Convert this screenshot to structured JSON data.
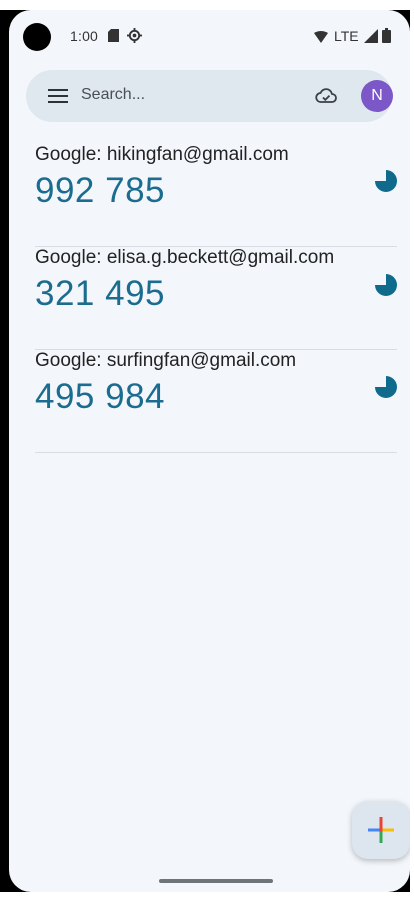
{
  "status_bar": {
    "time": "1:00",
    "network": "LTE",
    "icons": [
      "camera-cutout",
      "sd-card-icon",
      "gear-icon",
      "wifi-icon",
      "signal-icon",
      "battery-icon"
    ]
  },
  "search": {
    "placeholder": "Search...",
    "left_icon": "menu-icon",
    "right_icon": "cloud-sync-icon",
    "avatar_letter": "N",
    "avatar_color": "#7b57c7"
  },
  "accounts": [
    {
      "name": "Google: hikingfan@gmail.com",
      "code": "992 785",
      "timer_icon": "timer-icon"
    },
    {
      "name": "Google: elisa.g.beckett@gmail.com",
      "code": "321 495",
      "timer_icon": "timer-icon"
    },
    {
      "name": "Google: surfingfan@gmail.com",
      "code": "495 984",
      "timer_icon": "timer-icon"
    }
  ],
  "fab": {
    "icon": "add-icon"
  },
  "colors": {
    "background": "#f3f7fc",
    "search_bar": "#dfe7ef",
    "code_text": "#1b6c8e",
    "timer": "#0f6a8c",
    "avatar": "#7b57c7"
  }
}
